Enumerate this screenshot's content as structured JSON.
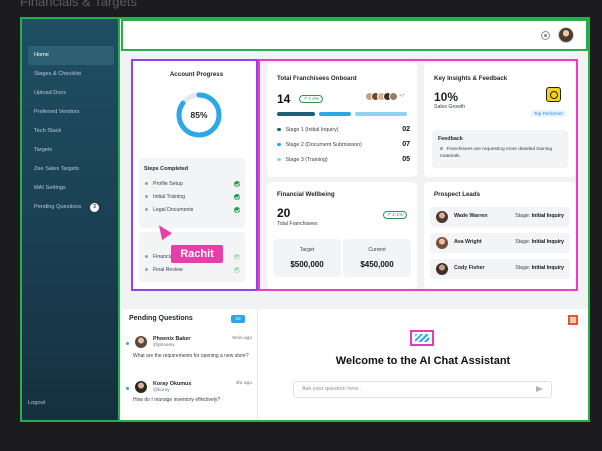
{
  "page_title": "Financials & Targets",
  "sidebar": {
    "items": [
      {
        "label": "Home"
      },
      {
        "label": "Stages & Checklist"
      },
      {
        "label": "Upload Docs"
      },
      {
        "label": "Preferred Vendors"
      },
      {
        "label": "Tech Stack"
      },
      {
        "label": "Targets"
      },
      {
        "label": "Zee Sales Targets"
      },
      {
        "label": "MAI Settings"
      },
      {
        "label": "Pending Questions",
        "badge": "3"
      }
    ],
    "logout": "Logout"
  },
  "account_progress": {
    "title": "Account Progress",
    "value": "85%",
    "percent": 85,
    "steps_completed_title": "Steps Completed",
    "completed_steps": [
      "Profile Setup",
      "Initial Training",
      "Legal Documents"
    ],
    "remaining_steps": [
      "Financial Integration",
      "Final Review"
    ]
  },
  "cursor_label": "Rachit",
  "franchisees": {
    "title": "Total Franchisees Onboard",
    "count": "14",
    "trend": "7.4%",
    "more": "+7",
    "stages": [
      {
        "label": "Stage 1 (Initial Inquiry)",
        "value": "02",
        "color": "#1f5f7a"
      },
      {
        "label": "Stage 2 (Document Submission)",
        "value": "07",
        "color": "#2aa8e8"
      },
      {
        "label": "Stage 3 (Training)",
        "value": "05",
        "color": "#8fd3f2"
      }
    ]
  },
  "insights": {
    "title": "Key Insights & Feedback",
    "value": "10%",
    "label": "Sales Growth",
    "badge": "Top Performer",
    "feedback_title": "Feedback",
    "feedback_text": "Franchisees are requesting more detailed training materials."
  },
  "financial": {
    "title": "Financial Wellbeing",
    "value": "20",
    "label": "Total Franchisees",
    "trend": "2.1%",
    "target_label": "Target",
    "target_value": "$500,000",
    "current_label": "Current",
    "current_value": "$450,000"
  },
  "leads": {
    "title": "Prospect Leads",
    "stage_prefix": "Stage:",
    "items": [
      {
        "name": "Wade Warren",
        "stage": "Initial Inquiry"
      },
      {
        "name": "Ava Wright",
        "stage": "Initial Inquiry"
      },
      {
        "name": "Cody Fisher",
        "stage": "Initial Inquiry"
      }
    ]
  },
  "pending": {
    "title": "Pending Questions",
    "count": "10",
    "questions": [
      {
        "name": "Phoenix Baker",
        "handle": "@phoenix",
        "time": "5min ago",
        "text": "What are the requirements for opening a new store?"
      },
      {
        "name": "Koray Okumus",
        "handle": "@koray",
        "time": "4hr ago",
        "text": "How do I manage inventory effectively?"
      }
    ]
  },
  "chat": {
    "title": "Welcome to the AI Chat Assistant",
    "placeholder": "Ask your question here.."
  },
  "colors": {
    "accent": "#2aa8e8",
    "sidebar": "#1f4f63",
    "success": "#1f9d47",
    "outline_green": "#27b04a",
    "outline_purple": "#8e44e8",
    "outline_pink": "#f03ac3"
  }
}
